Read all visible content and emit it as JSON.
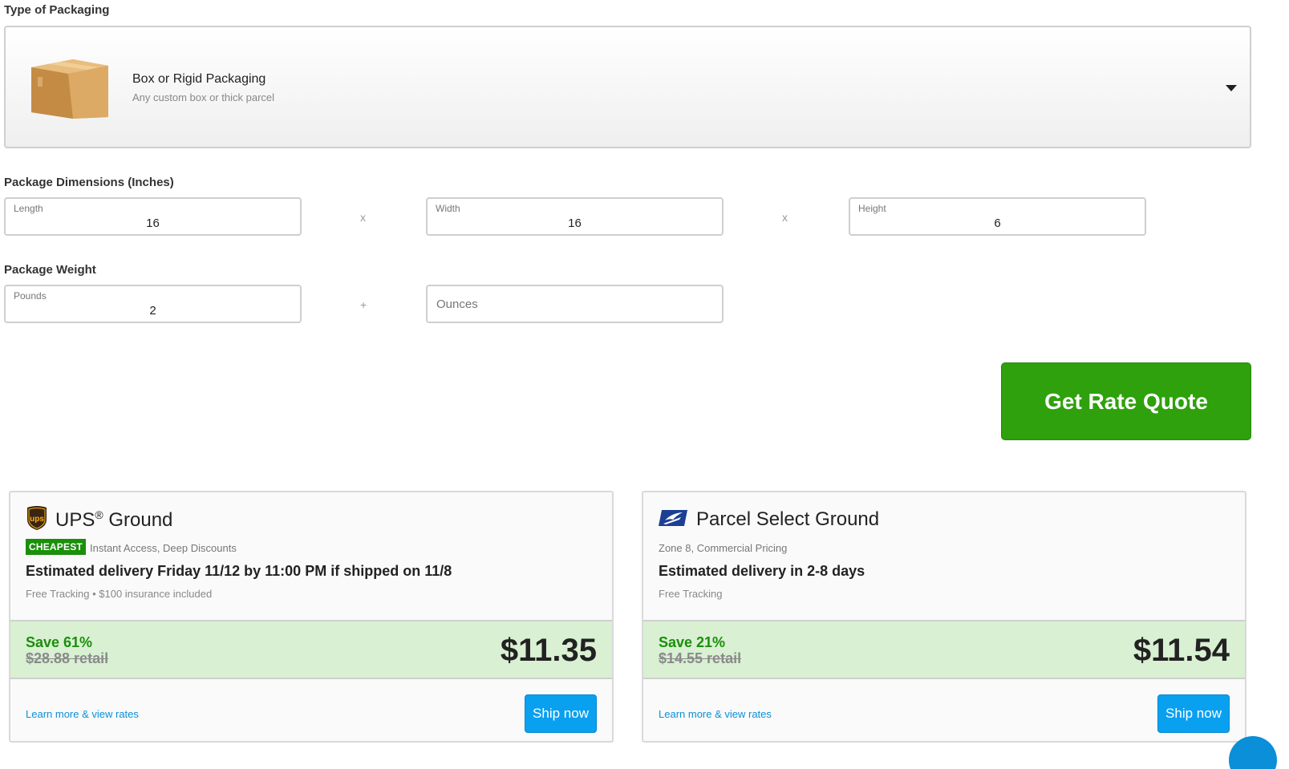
{
  "packaging": {
    "label": "Type of Packaging",
    "selected_title": "Box or Rigid Packaging",
    "selected_subtitle": "Any custom box or thick parcel"
  },
  "dimensions": {
    "label": "Package Dimensions (Inches)",
    "length": {
      "label": "Length",
      "value": "16"
    },
    "width": {
      "label": "Width",
      "value": "16"
    },
    "height": {
      "label": "Height",
      "value": "6"
    },
    "separator": "x"
  },
  "weight": {
    "label": "Package Weight",
    "pounds": {
      "label": "Pounds",
      "value": "2"
    },
    "separator": "+",
    "ounces_placeholder": "Ounces"
  },
  "quote_button": "Get Rate Quote",
  "rates": [
    {
      "carrier": "UPS",
      "service": "UPS",
      "service_suffix": " Ground",
      "registered": "®",
      "badge": "CHEAPEST",
      "tagline": "Instant Access, Deep Discounts",
      "delivery": "Estimated delivery Friday 11/12 by 11:00 PM if shipped on 11/8",
      "features": "Free Tracking • $100 insurance included",
      "save": "Save 61%",
      "retail": "$28.88 retail",
      "price": "$11.35",
      "learn_more": "Learn more & view rates",
      "ship_now": "Ship now"
    },
    {
      "carrier": "USPS",
      "service": "Parcel Select Ground",
      "tagline": "Zone 8, Commercial Pricing",
      "delivery": "Estimated delivery in 2-8 days",
      "features": "Free Tracking",
      "save": "Save 21%",
      "retail": "$14.55 retail",
      "price": "$11.54",
      "learn_more": "Learn more & view rates",
      "ship_now": "Ship now"
    }
  ],
  "icons": {
    "box": "box-icon",
    "ups": "ups-logo-icon",
    "usps": "usps-eagle-icon",
    "dropdown": "chevron-down-icon"
  },
  "colors": {
    "accent_green": "#2ea10c",
    "ship_blue": "#0aa0f0",
    "savings_band": "#d9f0d3"
  }
}
